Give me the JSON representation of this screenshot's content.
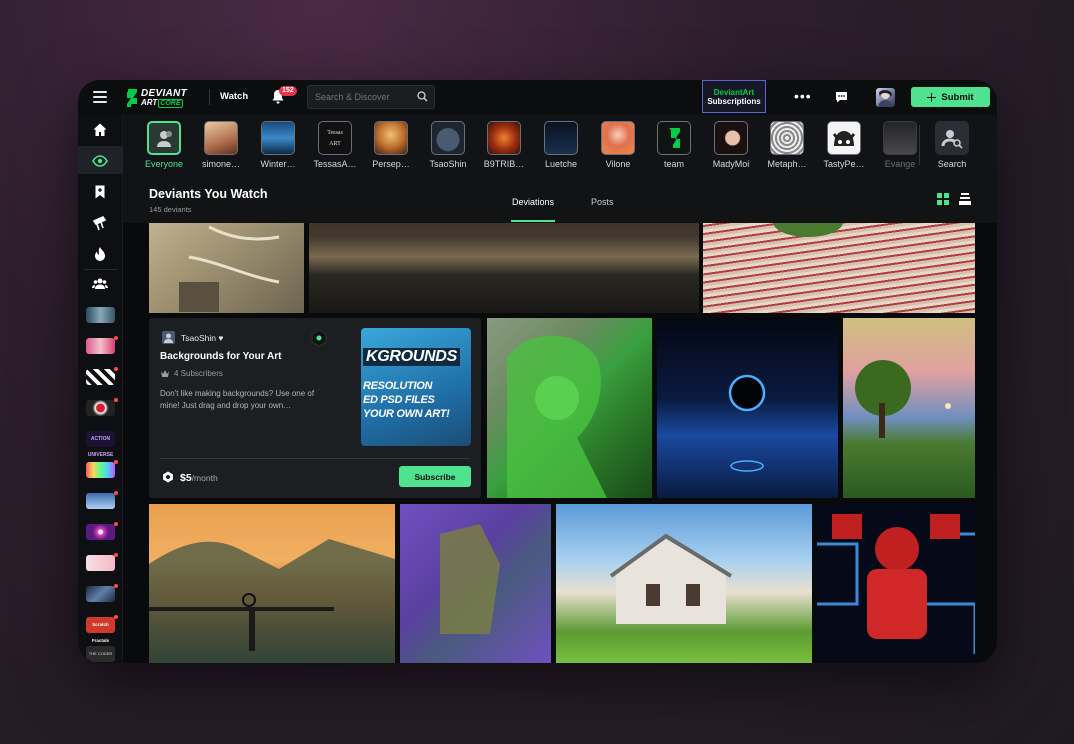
{
  "topbar": {
    "logo_line1": "DEVIANT",
    "logo_line2": "ART",
    "logo_badge": "CORE",
    "watch_label": "Watch",
    "notification_count": "152",
    "search_placeholder": "Search & Discover",
    "subscriptions_line1": "DeviantArt",
    "subscriptions_line2": "Subscriptions",
    "more_label": "•••",
    "submit_label": "Submit"
  },
  "watch_strip": {
    "items": [
      {
        "label": "Everyone",
        "active": true
      },
      {
        "label": "simone…"
      },
      {
        "label": "Winter…"
      },
      {
        "label": "TessasA…"
      },
      {
        "label": "Persep…"
      },
      {
        "label": "TsaoShin"
      },
      {
        "label": "B9TRIB…"
      },
      {
        "label": "Luetche"
      },
      {
        "label": "Vilone"
      },
      {
        "label": "team"
      },
      {
        "label": "MadyMoi"
      },
      {
        "label": "Metaph…"
      },
      {
        "label": "TastyPe…"
      },
      {
        "label": "Evange"
      }
    ],
    "search_label": "Search"
  },
  "section": {
    "title": "Deviants You Watch",
    "subtitle": "145 deviants",
    "tabs": [
      "Deviations",
      "Posts"
    ],
    "active_tab": "Deviations"
  },
  "card": {
    "username": "TsaoShin",
    "title": "Backgrounds for Your Art",
    "subscribers": "4 Subscribers",
    "description": "Don't like making backgrounds? Use one of mine! Just drag and drop your own…",
    "price": "$5",
    "price_period": "/month",
    "subscribe_label": "Subscribe",
    "image_text": [
      "KGROUNDS",
      "RESOLUTION",
      "ED PSD FILES",
      "YOUR OWN ART!"
    ]
  },
  "sidebar": {
    "icons": [
      "home-icon",
      "watch-eye-icon",
      "bookmark-icon",
      "shop-icon",
      "trending-fire-icon",
      "groups-icon"
    ],
    "thumb_text": [
      "ACTION UNIVERSE",
      "Scratch Fractals",
      "THE CODER"
    ]
  },
  "colors": {
    "accent": "#4fe38f",
    "brand_green": "#05cc47",
    "notification": "#e0364a",
    "subs_border": "#5a64d8"
  }
}
